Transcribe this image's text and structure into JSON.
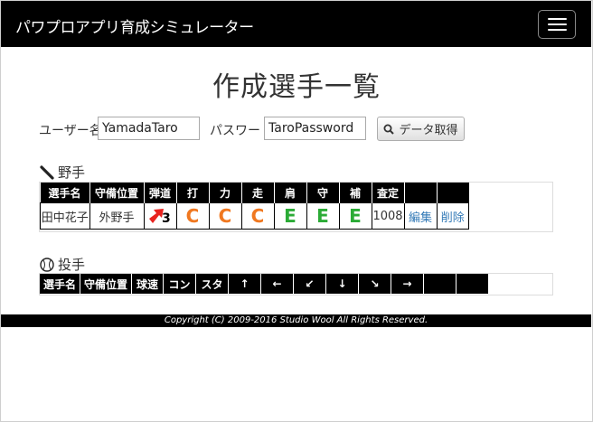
{
  "app": {
    "brand": "パワプロアプリ育成シミュレーター",
    "page_title": "作成選手一覧"
  },
  "form": {
    "user_label": "ユーザー名:",
    "user_value": "YamadaTaro",
    "password_label": "パスワード:",
    "password_value": "TaroPassword",
    "fetch_button": "データ取得"
  },
  "fielders": {
    "title": "野手",
    "headers": [
      "選手名",
      "守備位置",
      "弾道",
      "打",
      "力",
      "走",
      "肩",
      "守",
      "補",
      "査定",
      "",
      ""
    ],
    "row": {
      "name": "田中花子",
      "position": "外野手",
      "trajectory": "3",
      "grades": [
        "C",
        "C",
        "C",
        "E",
        "E",
        "E"
      ],
      "rating": "1008",
      "edit": "編集",
      "delete": "削除"
    },
    "colors": {
      "C": "#f07820",
      "E": "#2bab36",
      "trajectory_arrow": "#e8231f"
    }
  },
  "pitchers": {
    "title": "投手",
    "headers": [
      "選手名",
      "守備位置",
      "球速",
      "コン",
      "スタ",
      "↑",
      "←",
      "↙",
      "↓",
      "↘",
      "→",
      "",
      ""
    ]
  },
  "footer": {
    "copyright": "Copyright (C) 2009-2016 Studio Wool All Rights Reserved."
  }
}
